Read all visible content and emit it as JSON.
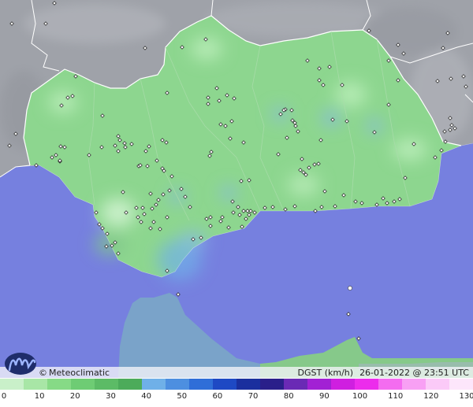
{
  "credit": {
    "symbol": "©",
    "brand": "Meteoclimatic"
  },
  "stamp": {
    "variable": "DGST (km/h)",
    "datetime": "26-01-2022 @ 23:51 UTC"
  },
  "legend": {
    "ticks": [
      "0",
      "10",
      "20",
      "30",
      "40",
      "50",
      "60",
      "70",
      "80",
      "90",
      "100",
      "110",
      "120",
      "130"
    ],
    "colors": [
      "#c9f0c9",
      "#a8e6a6",
      "#86da86",
      "#6ecc74",
      "#5cbb66",
      "#4cab5a",
      "#6fb0e8",
      "#4d8fe0",
      "#2f6ed8",
      "#1e49c4",
      "#1a2f9e",
      "#2a1f8a",
      "#6a2ab5",
      "#a221d4",
      "#cf1fe0",
      "#ec2cec",
      "#f46cf0",
      "#f8a0f4",
      "#fbcaf8",
      "#fde6fb"
    ]
  },
  "map": {
    "colors": {
      "sea": "#7680df",
      "land_out": "#9fa2a9",
      "andalucia": "#8dd68f",
      "africa_land": "#7aa3c9",
      "border": "#ffffff",
      "station": "#ffffff"
    },
    "icons": [
      "station-marker-icon",
      "meteoclimatic-logo-icon"
    ]
  }
}
